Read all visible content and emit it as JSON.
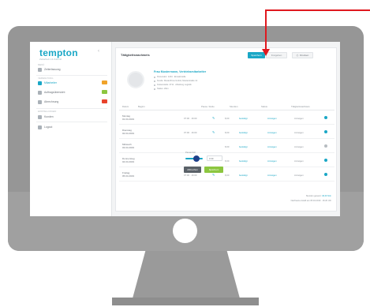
{
  "app": {
    "logo": "tempton",
    "logo_tagline": "Zeitarbeit mit Zukunft",
    "toggle_icon": "chevron-left-icon"
  },
  "sidebar": {
    "items": [
      {
        "label": "Zeiterfassung",
        "active": false,
        "badge_color": null
      },
      {
        "label": "Mitarbeiter",
        "active": true,
        "badge_color": "#f0a32a"
      },
      {
        "label": "Auftragsübersicht",
        "active": false,
        "badge_color": "#8cc63f"
      },
      {
        "label": "Abrechnung",
        "active": false,
        "badge_color": "#e8432c"
      },
      {
        "label": "Kunden",
        "active": false,
        "badge_color": null
      },
      {
        "label": "Logout",
        "active": false,
        "badge_color": null
      }
    ],
    "sections": [
      "Menü",
      "Verwaltung",
      "Einstellungen"
    ]
  },
  "panel": {
    "title": "Tätigkeitsnachweis",
    "buttons": {
      "primary": "Speichern",
      "secondary": "Freigeben",
      "print": "Drucken",
      "print_icon": "printer-icon"
    },
    "profile": {
      "name": "Frau Mustermann, Vertriebsmitarbeiter",
      "lines": [
        "Personalnr. 1234 · Einsatzstelle",
        "Kunde: Musterfirma GmbH, Musterstraße 12",
        "Kostenstelle: 4711 · Abteilung Logistik",
        "Status: offen"
      ]
    },
    "table": {
      "headers": [
        "Datum",
        "Beginn",
        "Pause / Ende",
        "Stunden",
        "Status",
        "Tätigkeitsnachweis"
      ],
      "rows": [
        {
          "day": "Montag",
          "date": "01.04.2019",
          "time": "07:00 · 16:00",
          "hours": "8,00",
          "status": "bestätigt",
          "action": "Anzeigen"
        },
        {
          "day": "Dienstag",
          "date": "02.04.2019",
          "time": "07:00 · 16:00",
          "hours": "8,00",
          "status": "bestätigt",
          "action": "Anzeigen"
        },
        {
          "day": "Mittwoch",
          "date": "03.04.2019",
          "time": "",
          "hours": "8,00",
          "status": "bestätigt",
          "action": "Anzeigen"
        },
        {
          "day": "Donnerstag",
          "date": "04.04.2019",
          "time": "",
          "hours": "8,00",
          "status": "bestätigt",
          "action": "Anzeigen"
        },
        {
          "day": "Freitag",
          "date": "05.04.2019",
          "time": "07:00 · 16:00",
          "hours": "8,00",
          "status": "bestätigt",
          "action": "Anzeigen"
        }
      ]
    },
    "edit": {
      "label": "Pausenzeit",
      "select_value": "0:30",
      "cancel": "Abbrechen",
      "confirm": "Speichern"
    },
    "footer": {
      "line1_label": "Stunden gesamt:",
      "line1_value": "40,00 Std.",
      "line2": "Nachweis erstellt am 05.04.2019 · 16:20 Uhr"
    }
  },
  "colors": {
    "accent": "#1aa7c6",
    "annotation_arrow": "#e0181f",
    "confirm_green": "#8cc63f"
  }
}
